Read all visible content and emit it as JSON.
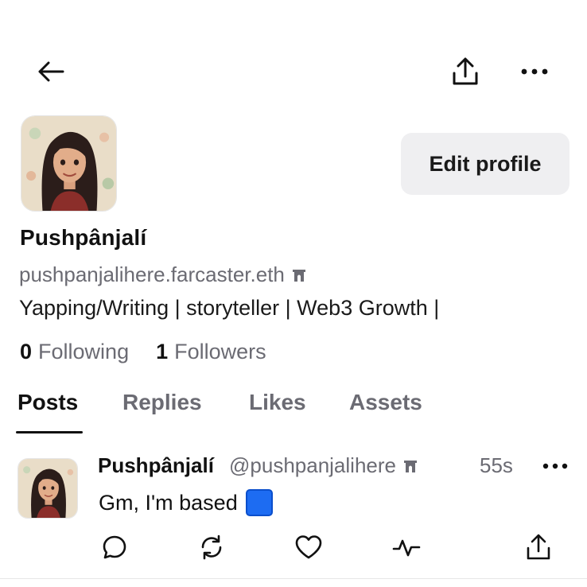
{
  "topbar": {
    "back_icon": "arrow-left-icon",
    "share_icon": "share-upload-icon",
    "more_icon": "ellipsis-horizontal-icon"
  },
  "profile": {
    "display_name": "Pushpânjalí",
    "handle": "pushpanjalihere.farcaster.eth",
    "bio": "Yapping/Writing | storyteller | Web3 Growth |",
    "edit_button_label": "Edit profile",
    "following_count": "0",
    "following_label": "Following",
    "followers_count": "1",
    "followers_label": "Followers"
  },
  "tabs": [
    {
      "label": "Posts",
      "active": true
    },
    {
      "label": "Replies",
      "active": false
    },
    {
      "label": "Likes",
      "active": false
    },
    {
      "label": "Assets",
      "active": false
    }
  ],
  "post": {
    "author_name": "Pushpânjalí",
    "author_handle": "@pushpanjalihere",
    "time": "55s",
    "text": "Gm, I'm based",
    "emoji": "blue-square",
    "actions": [
      "reply-icon",
      "recast-icon",
      "like-icon",
      "activity-icon",
      "share-icon"
    ]
  },
  "colors": {
    "accent_blue": "#1d6cf2",
    "muted_text": "#6b6b73",
    "button_bg": "#efeff1"
  }
}
